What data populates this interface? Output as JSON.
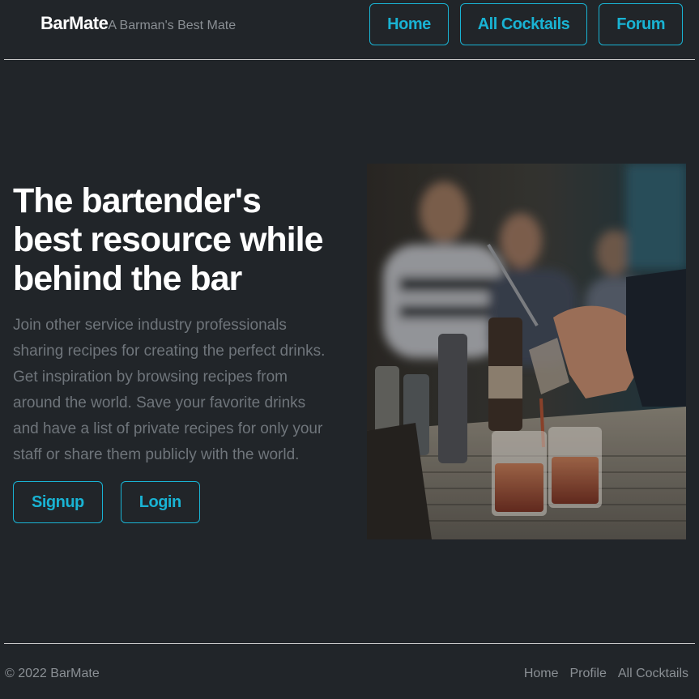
{
  "header": {
    "brand_name": "BarMate",
    "tagline": "A Barman's Best Mate",
    "nav": [
      {
        "label": "Home"
      },
      {
        "label": "All Cocktails"
      },
      {
        "label": "Forum"
      }
    ]
  },
  "hero": {
    "title_lines": [
      "The bartender's",
      "best resource while",
      "behind the bar"
    ],
    "lead": "Join other service industry professionals sharing recipes for creating the perfect drinks. Get inspiration by browsing recipes from around the world. Save your favorite drinks and have a list of private recipes for only your staff or share them publicly with the world.",
    "signup_label": "Signup",
    "login_label": "Login",
    "image_icon": "bartender-pouring-photo"
  },
  "footer": {
    "copyright": "© 2022 BarMate",
    "links": [
      {
        "label": "Home"
      },
      {
        "label": "Profile"
      },
      {
        "label": "All Cocktails"
      }
    ]
  },
  "colors": {
    "background": "#212529",
    "accent": "#19b3d3",
    "muted_text": "#6f757b"
  }
}
